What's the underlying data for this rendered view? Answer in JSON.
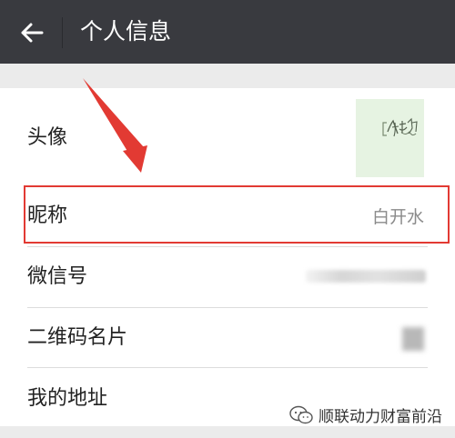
{
  "header": {
    "title": "个人信息",
    "back_icon": "arrow-left-icon"
  },
  "profile": {
    "rows": [
      {
        "label": "头像"
      },
      {
        "label": "昵称",
        "value": "白开水"
      },
      {
        "label": "微信号"
      },
      {
        "label": "二维码名片"
      },
      {
        "label": "我的地址"
      }
    ]
  },
  "annotation": {
    "highlight_color": "#e23a33"
  },
  "watermark": {
    "text": "顺联动力财富前沿"
  }
}
